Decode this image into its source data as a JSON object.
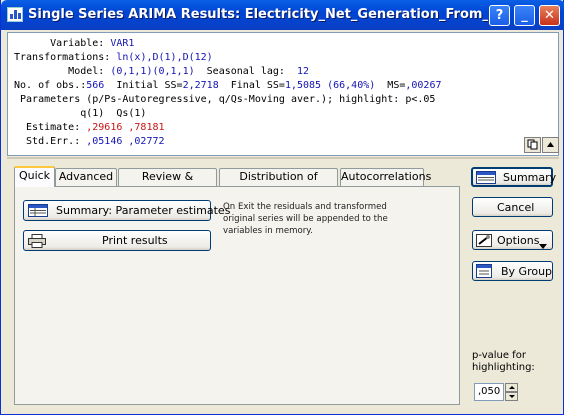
{
  "window": {
    "title": "Single Series ARIMA Results: Electricity_Net_Generation_From_Coal_Electr",
    "help_glyph": "?",
    "minimize_glyph": "_",
    "close_glyph": "✕"
  },
  "output": {
    "line1_label": "      Variable: ",
    "line1_value": "VAR1",
    "line2_label": "Transformations: ",
    "line2_value": "ln(x),D(1),D(12)",
    "line3_label": "         Model: ",
    "line3_value": "(0,1,1)(0,1,1)",
    "line3_label2": "  Seasonal lag: ",
    "line3_value2": " 12",
    "line4_label": "No. of obs.:",
    "line4_obs": "566",
    "line4_initial_label": "  Initial SS=",
    "line4_initial": "2,2718",
    "line4_final_label": "  Final SS=",
    "line4_final": "1,5085 (66,40%)",
    "line4_ms_label": "  MS=",
    "line4_ms": ",00267",
    "line5": " Parameters (p/Ps-Autoregressive, q/Qs-Moving aver.); highlight: p<.05",
    "col_headers": "           q(1)  Qs(1)",
    "estimate_label": "  Estimate: ",
    "estimate_values": ",29616 ,78181",
    "stderr_label": "  Std.Err.: ",
    "stderr_values": ",05146 ,02772"
  },
  "tabs": [
    {
      "label": "Quick",
      "active": true
    },
    {
      "label": "Advanced",
      "active": false
    },
    {
      "label": "Review & residuals",
      "active": false
    },
    {
      "label": "Distribution of residuals",
      "active": false
    },
    {
      "label": "Autocorrelations",
      "active": false
    }
  ],
  "quick": {
    "summary_params_label": "Summary:  Parameter estimates",
    "print_results_label": "Print results",
    "note": "On Exit the residuals and transformed original series will be appended to the variables in memory."
  },
  "right_buttons": {
    "summary": "Summary",
    "cancel": "Cancel",
    "options": "Options",
    "by_group": "By Group"
  },
  "pvalue": {
    "label": "p-value for highlighting:",
    "value": ",050"
  },
  "colors": {
    "titlebar": "#0046d5",
    "highlight_red": "#c81414",
    "value_blue": "#1414b4",
    "active_tab_accent": "#ffc83c"
  }
}
